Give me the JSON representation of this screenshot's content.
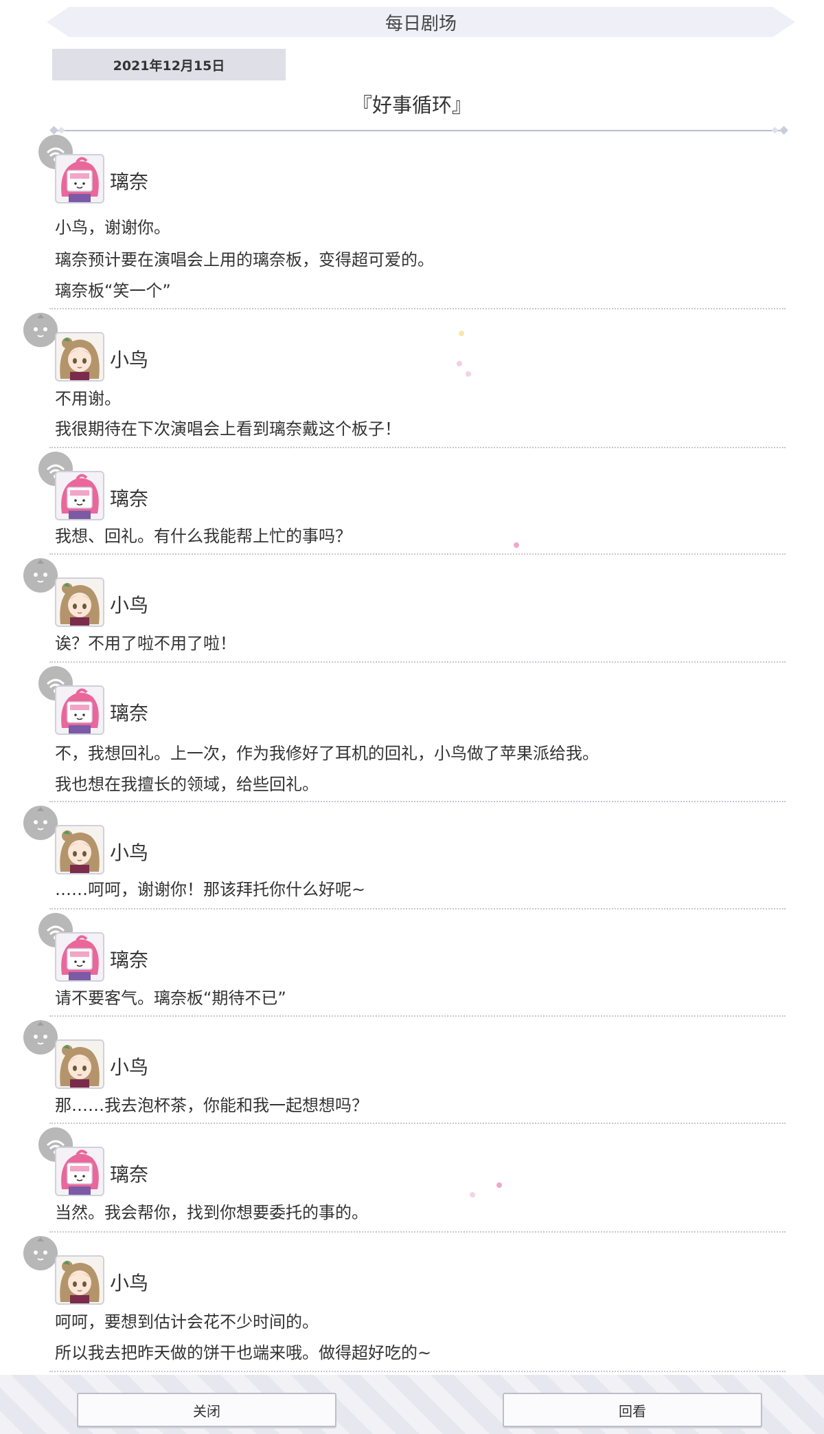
{
  "header": {
    "title": "每日剧场"
  },
  "date": "2021年12月15日",
  "episode_title": "『好事循环』",
  "entries": [
    {
      "speaker": "璃奈",
      "lines": [
        "小鸟，谢谢你。",
        "璃奈预计要在演唱会上用的璃奈板，变得超可爱的。",
        "璃奈板“笑一个”"
      ]
    },
    {
      "speaker": "小鸟",
      "lines": [
        "不用谢。",
        "我很期待在下次演唱会上看到璃奈戴这个板子！"
      ]
    },
    {
      "speaker": "璃奈",
      "lines": [
        "我想、回礼。有什么我能帮上忙的事吗？"
      ]
    },
    {
      "speaker": "小鸟",
      "lines": [
        "诶？不用了啦不用了啦！"
      ]
    },
    {
      "speaker": "璃奈",
      "lines": [
        "不，我想回礼。上一次，作为我修好了耳机的回礼，小鸟做了苹果派给我。",
        "我也想在我擅长的领域，给些回礼。"
      ]
    },
    {
      "speaker": "小鸟",
      "lines": [
        "……呵呵，谢谢你！那该拜托你什么好呢~"
      ]
    },
    {
      "speaker": "璃奈",
      "lines": [
        "请不要客气。璃奈板“期待不已”"
      ]
    },
    {
      "speaker": "小鸟",
      "lines": [
        "那……我去泡杯茶，你能和我一起想想吗？"
      ]
    },
    {
      "speaker": "璃奈",
      "lines": [
        "当然。我会帮你，找到你想要委托的事的。"
      ]
    },
    {
      "speaker": "小鸟",
      "lines": [
        "呵呵，要想到估计会花不少时间的。",
        "所以我去把昨天做的饼干也端来哦。做得超好吃的~"
      ]
    }
  ],
  "footer": {
    "close_label": "关闭",
    "replay_label": "回看"
  },
  "colors": {
    "rina_hair": "#e9679b",
    "kotori_hair": "#b4956b",
    "accent": "#dedfe7"
  }
}
